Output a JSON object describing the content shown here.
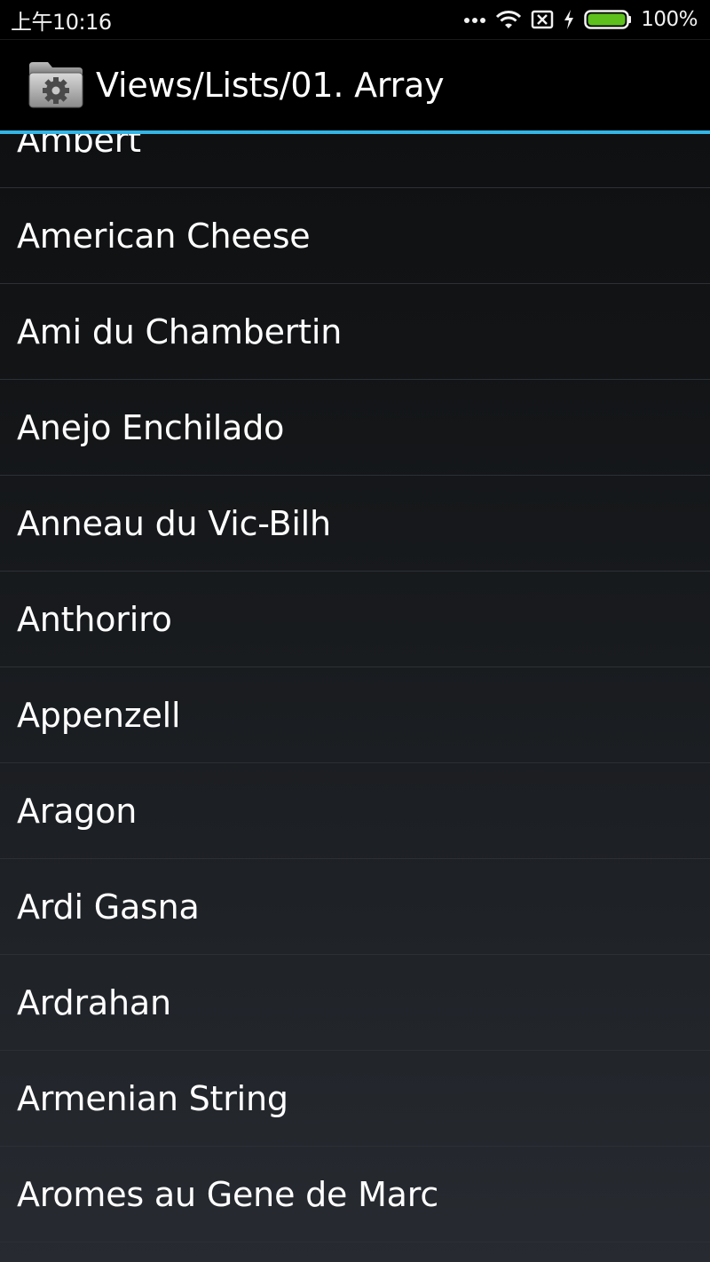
{
  "status_bar": {
    "time": "上午10:16",
    "battery_percent": "100%",
    "icons": [
      "more-dots-icon",
      "wifi-icon",
      "no-sim-icon",
      "charging-bolt-icon",
      "battery-icon"
    ],
    "battery_color": "#5ec01d"
  },
  "action_bar": {
    "icon": "settings-folder-icon",
    "title": "Views/Lists/01. Array",
    "accent_color": "#33b5e5"
  },
  "list": {
    "items": [
      {
        "label": "Ambert"
      },
      {
        "label": "American Cheese"
      },
      {
        "label": "Ami du Chambertin"
      },
      {
        "label": "Anejo Enchilado"
      },
      {
        "label": "Anneau du Vic-Bilh"
      },
      {
        "label": "Anthoriro"
      },
      {
        "label": "Appenzell"
      },
      {
        "label": "Aragon"
      },
      {
        "label": "Ardi Gasna"
      },
      {
        "label": "Ardrahan"
      },
      {
        "label": "Armenian String"
      },
      {
        "label": "Aromes au Gene de Marc"
      }
    ]
  }
}
